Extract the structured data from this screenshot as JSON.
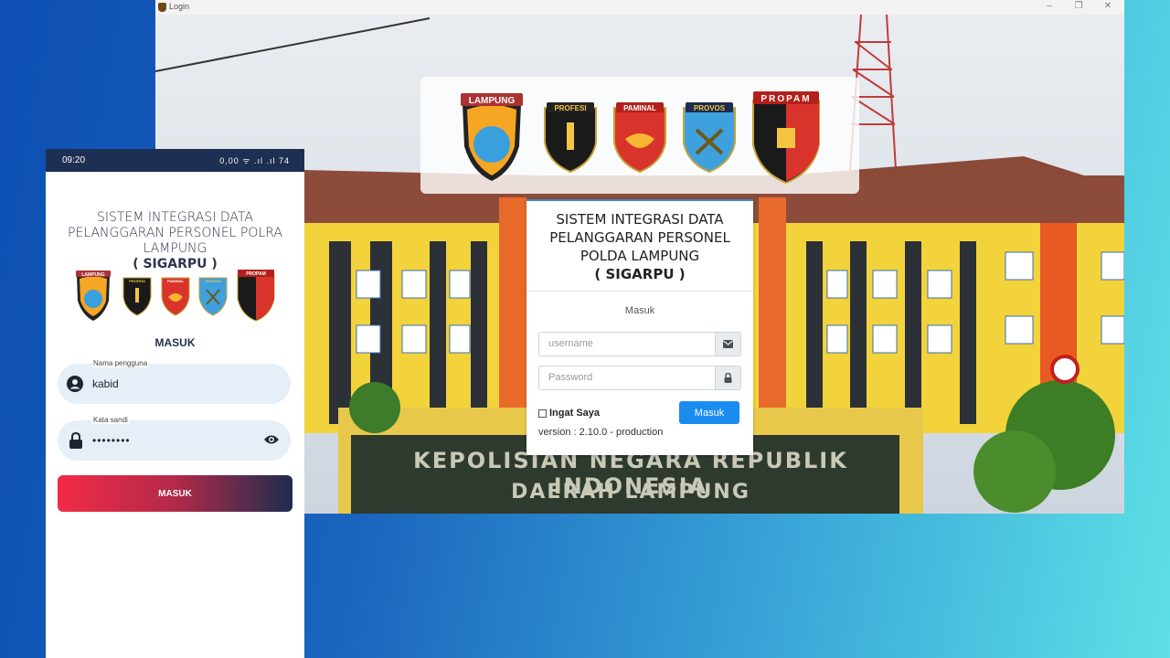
{
  "window": {
    "title": "Login",
    "controls": {
      "minimize": "–",
      "maximize": "❐",
      "close": "✕"
    },
    "background_sign": {
      "line1": "KEPOLISIAN NEGARA REPUBLIK INDONESIA",
      "line2": "DAERAH LAMPUNG"
    },
    "logos": [
      "LAMPUNG",
      "PROFESI",
      "PAMINAL",
      "PROVOS",
      "PROPAM"
    ],
    "card": {
      "title_line1": "SISTEM INTEGRASI DATA PELANGGARAN PERSONEL POLDA LAMPUNG",
      "title_line2": "( SIGARPU )",
      "subtitle": "Masuk",
      "username_placeholder": "username",
      "password_placeholder": "Password",
      "remember_label": "Ingat Saya",
      "submit_label": "Masuk",
      "version": "version : 2.10.0 - production"
    }
  },
  "phone": {
    "status": {
      "time": "09:20",
      "icons": "0,00 ᯤ .ıl .ıl 74"
    },
    "title_line1": "SISTEM INTEGRASI DATA PELANGGARAN PERSONEL POLRA LAMPUNG",
    "title_line2": "( SIGARPU )",
    "logos": [
      "LAMPUNG",
      "PROFESI",
      "PAMINAL",
      "PROVOS",
      "PROPAM"
    ],
    "heading": "MASUK",
    "username_label": "Nama pengguna",
    "username_value": "kabid",
    "password_label": "Kata sandi",
    "password_value": "••••••••",
    "submit_label": "MASUK"
  },
  "colors": {
    "primary_blue": "#1a8cf0",
    "navy": "#1d2f52",
    "accent_red": "#f22b47"
  }
}
